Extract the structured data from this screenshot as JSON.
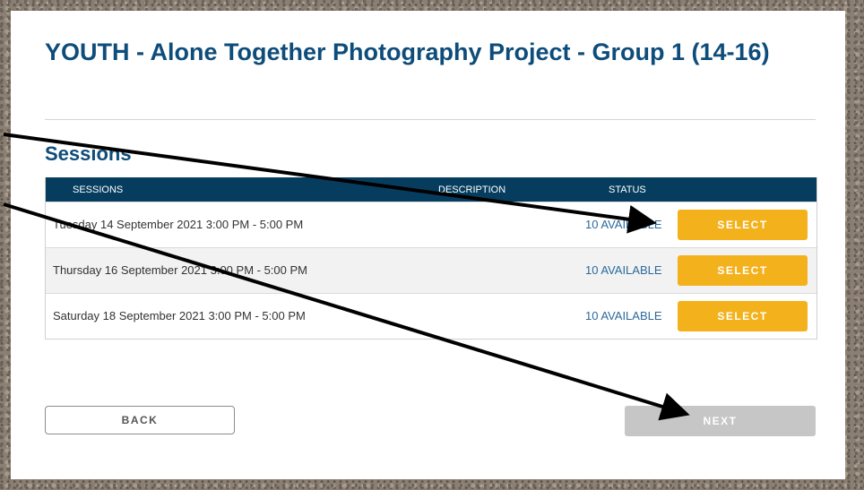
{
  "page": {
    "title": "YOUTH - Alone Together Photography Project - Group 1 (14-16)",
    "sessions_heading": "Sessions"
  },
  "table": {
    "headers": {
      "sessions": "SESSIONS",
      "description": "DESCRIPTION",
      "status": "STATUS"
    },
    "rows": [
      {
        "date": "Tuesday 14 September 2021 3:00 PM - 5:00 PM",
        "status": "10 AVAILABLE",
        "action": "SELECT"
      },
      {
        "date": "Thursday 16 September 2021 3:00 PM - 5:00 PM",
        "status": "10 AVAILABLE",
        "action": "SELECT"
      },
      {
        "date": "Saturday 18 September 2021 3:00 PM - 5:00 PM",
        "status": "10 AVAILABLE",
        "action": "SELECT"
      }
    ]
  },
  "nav": {
    "back_label": "BACK",
    "next_label": "NEXT"
  },
  "colors": {
    "title": "#0e4c7a",
    "header_bg": "#063d5f",
    "select_button": "#f3b21c",
    "next_disabled": "#c6c6c6",
    "status_text": "#2b6a9b"
  },
  "annotations": {
    "arrow_color": "#000000",
    "arrow_count": 2
  }
}
